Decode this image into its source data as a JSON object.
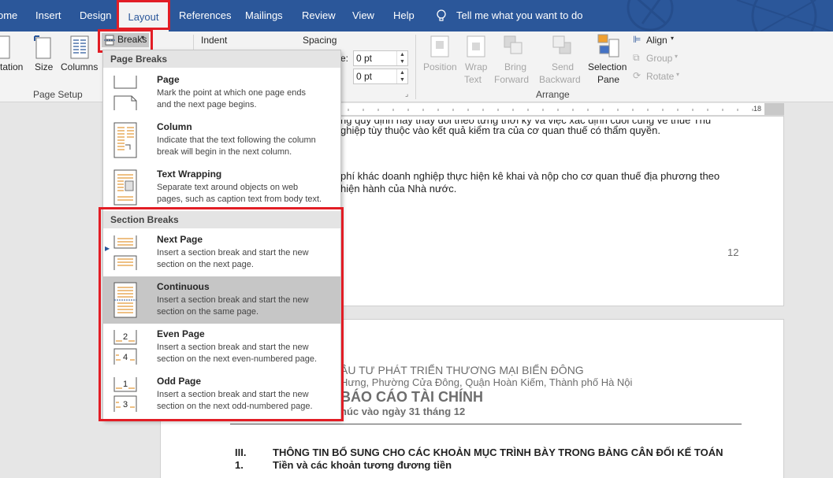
{
  "tabs": [
    "ome",
    "Insert",
    "Design",
    "Layout",
    "References",
    "Mailings",
    "Review",
    "View",
    "Help"
  ],
  "active_tab": "Layout",
  "tell_me": "Tell me what you want to do",
  "ribbon": {
    "orientation_label": "tation",
    "size_label": "Size",
    "columns_label": "Columns",
    "breaks_label": "Breaks",
    "page_setup_label": "Page Setup",
    "indent_label": "Indent",
    "spacing_label": "Spacing",
    "before_label": "e:",
    "before_value": "0 pt",
    "after_value": "0 pt",
    "position_label": "Position",
    "wrap_text_label_1": "Wrap",
    "wrap_text_label_2": "Text",
    "bring_forward_label_1": "Bring",
    "bring_forward_label_2": "Forward",
    "send_backward_label_1": "Send",
    "send_backward_label_2": "Backward",
    "selection_pane_label_1": "Selection",
    "selection_pane_label_2": "Pane",
    "align_label": "Align",
    "group_label": "Group",
    "rotate_label": "Rotate",
    "arrange_label": "Arrange"
  },
  "ruler": {
    "label": "18"
  },
  "dropdown": {
    "page_breaks_header": "Page Breaks",
    "section_breaks_header": "Section Breaks",
    "items": [
      {
        "title": "Page",
        "line1": "Mark the point at which one page ends",
        "line2": "and the next page begins."
      },
      {
        "title": "Column",
        "line1": "Indicate that the text following the column",
        "line2": "break will begin in the next column."
      },
      {
        "title": "Text Wrapping",
        "line1": "Separate text around objects on web",
        "line2": "pages, such as caption text from body text."
      },
      {
        "title": "Next Page",
        "line1": "Insert a section break and start the new",
        "line2": "section on the next page."
      },
      {
        "title": "Continuous",
        "line1": "Insert a section break and start the new",
        "line2": "section on the same page."
      },
      {
        "title": "Even Page",
        "line1": "Insert a section break and start the new",
        "line2": "section on the next even-numbered page."
      },
      {
        "title": "Odd Page",
        "line1": "Insert a section break and start the new",
        "line2": "section on the next odd-numbered page."
      }
    ],
    "selected_index": 4,
    "even_icon_digits": [
      "2",
      "4"
    ],
    "odd_icon_digits": [
      "1",
      "3"
    ]
  },
  "document": {
    "line_top_partial": "ng quy định hay thay đổi theo từng thời kỳ và việc xác định cuối cùng về thuế Thu",
    "line2": "ghiệp tùy thuộc vào kết quả kiểm tra của cơ quan thuế có thẩm quyền.",
    "line3": "phí khác doanh nghiệp thực hiện kê khai và nộp cho cơ quan thuế địa phương theo",
    "line4": "hiện hành của Nhà nước.",
    "page_number": "12",
    "company": "ẦU TƯ PHÁT TRIỂN THƯƠNG MẠI BIỂN ĐÔNG",
    "address": "Hưng, Phường Cửa Đông, Quận Hoàn Kiếm, Thành phố Hà Nội",
    "report_title": "BÁO CÁO TÀI CHÍNH",
    "report_subtitle": "húc vào ngày 31 tháng 12",
    "section_num": "III.",
    "section_text": "THÔNG TIN BỔ SUNG CHO CÁC KHOẢN MỤC TRÌNH BÀY TRONG BẢNG CÂN ĐỐI KẾ TOÁN",
    "item_num": "1.",
    "item_text": "Tiền và các khoản tương đương tiền"
  },
  "colors": {
    "word_blue": "#2b579a",
    "highlight_red": "#e21d25",
    "selected_gray": "#c6c6c6"
  }
}
